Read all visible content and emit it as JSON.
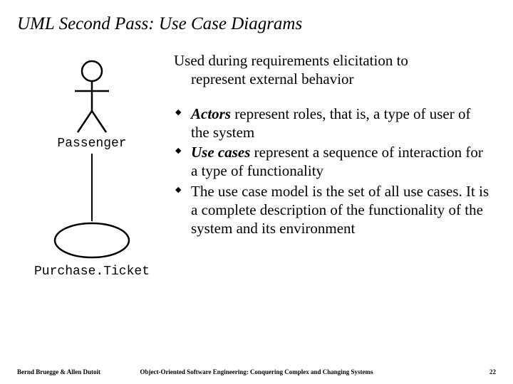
{
  "title": "UML Second Pass: Use Case Diagrams",
  "intro_line1": "Used during requirements elicitation to",
  "intro_line2": "represent external behavior",
  "bullets": [
    {
      "em": "Actors",
      "rest": " represent roles, that is, a type of user of the system"
    },
    {
      "em": "Use cases",
      "rest": " represent a sequence of interaction for a  type of functionality"
    },
    {
      "em": "",
      "rest": "The use case model is  the set of all use cases. It is a complete description of the functionality of the  system and its environment"
    }
  ],
  "diagram": {
    "actor_label": "Passenger",
    "usecase_label": "Purchase.Ticket"
  },
  "footer": {
    "left": "Bernd Bruegge & Allen Dutoit",
    "center": "Object-Oriented Software Engineering: Conquering Complex and Changing Systems",
    "right": "22"
  }
}
